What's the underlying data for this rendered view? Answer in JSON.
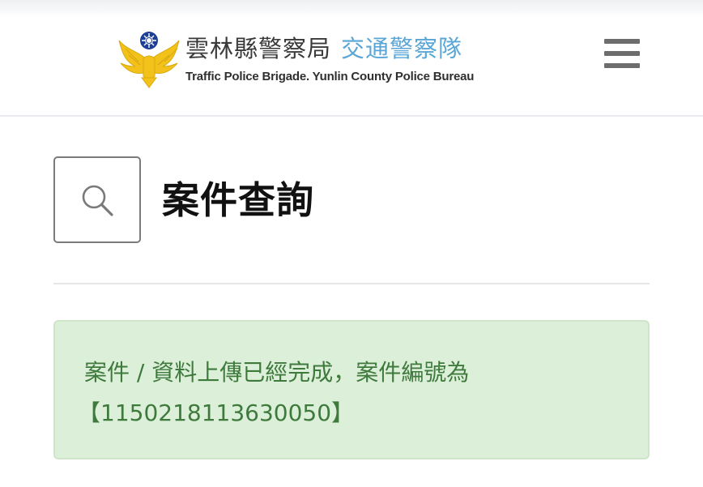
{
  "header": {
    "agency_cn": "雲林縣警察局",
    "unit_cn": "交通警察隊",
    "agency_en": "Traffic Police Brigade. Yunlin County Police Bureau",
    "logo_icon": "police-emblem-icon",
    "menu_icon": "hamburger-menu-icon"
  },
  "page": {
    "title": "案件查詢",
    "title_icon": "search-icon"
  },
  "alert": {
    "message": "案件 / 資料上傳已經完成，案件編號為",
    "case_number": "【1150218113630050】",
    "status": "success"
  },
  "colors": {
    "unit_blue": "#5aa6d6",
    "alert_bg": "#dcefd9",
    "alert_border": "#cfe5ca",
    "alert_text": "#3f7a3d",
    "menu_gray": "#6d6d6d",
    "emblem_gold": "#f2c21a",
    "emblem_blue": "#1c3f95"
  }
}
